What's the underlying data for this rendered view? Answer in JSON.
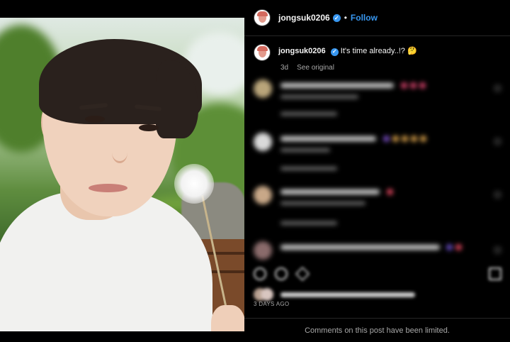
{
  "post": {
    "username": "jongsuk0206",
    "follow_label": "Follow",
    "separator": "•",
    "verified_glyph": "✓",
    "caption_text": "It's time already..!? 🤔",
    "age": "3d",
    "see_original": "See original",
    "timestamp": "3 DAYS AGO",
    "limited_notice": "Comments on this post have been limited."
  },
  "icons": {
    "avatar": "avatar-icon",
    "verified": "verified-badge-icon",
    "like": "heart-icon",
    "comment": "comment-icon",
    "share": "share-icon",
    "save": "bookmark-icon"
  },
  "colors": {
    "accent": "#3897f0",
    "background": "#000000",
    "muted_text": "#a8a8a8",
    "divider": "#262626"
  }
}
